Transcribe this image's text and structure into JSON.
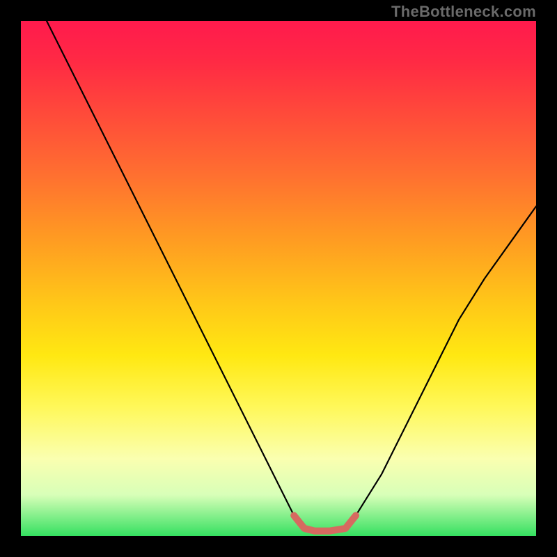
{
  "watermark": "TheBottleneck.com",
  "chart_data": {
    "type": "line",
    "title": "",
    "xlabel": "",
    "ylabel": "",
    "xlim": [
      0,
      100
    ],
    "ylim": [
      0,
      100
    ],
    "series": [
      {
        "name": "bottleneck-curve",
        "x": [
          5,
          10,
          15,
          20,
          25,
          30,
          35,
          40,
          45,
          50,
          53,
          55,
          57,
          60,
          63,
          65,
          70,
          75,
          80,
          85,
          90,
          95,
          100
        ],
        "values": [
          100,
          90,
          80,
          70,
          60,
          50,
          40,
          30,
          20,
          10,
          4,
          1.5,
          1,
          1,
          1.5,
          4,
          12,
          22,
          32,
          42,
          50,
          57,
          64
        ]
      },
      {
        "name": "sweet-spot-marker",
        "x": [
          53,
          55,
          57,
          60,
          63,
          65
        ],
        "values": [
          4,
          1.5,
          1,
          1,
          1.5,
          4
        ]
      }
    ],
    "gradient_stops": [
      {
        "pos": 0,
        "color": "#ff1a4d"
      },
      {
        "pos": 18,
        "color": "#ff4a3a"
      },
      {
        "pos": 42,
        "color": "#ff9a22"
      },
      {
        "pos": 65,
        "color": "#ffe812"
      },
      {
        "pos": 85,
        "color": "#faffb0"
      },
      {
        "pos": 100,
        "color": "#34e060"
      }
    ]
  }
}
